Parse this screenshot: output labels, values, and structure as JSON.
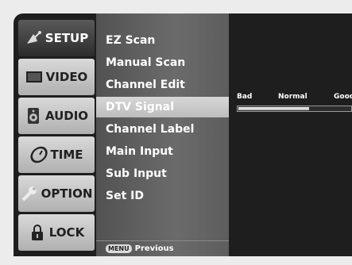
{
  "tabs": [
    {
      "label": "SETUP",
      "icon": "satellite-dish-icon",
      "active": true
    },
    {
      "label": "VIDEO",
      "icon": "tv-screen-icon",
      "active": false
    },
    {
      "label": "AUDIO",
      "icon": "speaker-icon",
      "active": false
    },
    {
      "label": "TIME",
      "icon": "clock-icon",
      "active": false
    },
    {
      "label": "OPTION",
      "icon": "wrench-icon",
      "active": false
    },
    {
      "label": "LOCK",
      "icon": "padlock-icon",
      "active": false
    }
  ],
  "menu": {
    "items": [
      {
        "label": "EZ Scan"
      },
      {
        "label": "Manual Scan"
      },
      {
        "label": "Channel Edit"
      },
      {
        "label": "DTV Signal",
        "selected": true
      },
      {
        "label": "Channel Label"
      },
      {
        "label": "Main Input"
      },
      {
        "label": "Sub Input"
      },
      {
        "label": "Set ID"
      }
    ],
    "footer": {
      "key": "MENU",
      "label": "Previous"
    }
  },
  "signal": {
    "labels": {
      "bad": "Bad",
      "normal": "Normal",
      "good": "Good"
    },
    "level_fraction": 0.63
  },
  "colors": {
    "frame": "#1e1e1e",
    "menu_bg": "#5f5f5f",
    "selected_bg": "#c8c8c8",
    "tab_bg": "#c4c4c4",
    "tab_active_bg": "#3a3a3a"
  }
}
